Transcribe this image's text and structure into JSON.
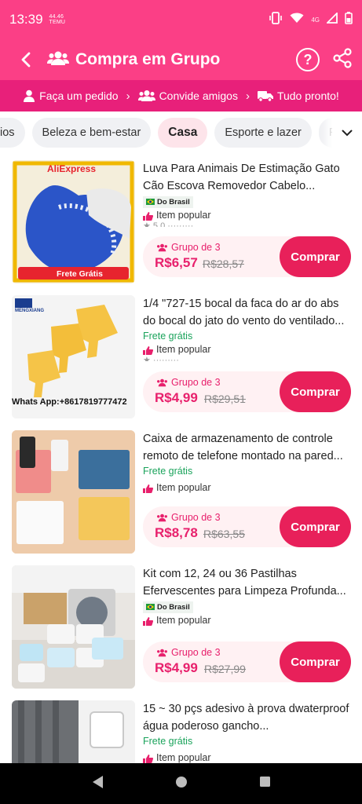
{
  "status": {
    "time": "13:39",
    "carrier": "44.46\nTEMU",
    "network": "4G"
  },
  "header": {
    "title": "Compra em Grupo"
  },
  "steps": [
    {
      "label": "Faça um pedido"
    },
    {
      "label": "Convide amigos"
    },
    {
      "label": "Tudo pronto!"
    }
  ],
  "categories": [
    {
      "label": "ios"
    },
    {
      "label": "Beleza e bem-estar"
    },
    {
      "label": "Casa"
    },
    {
      "label": "Esporte e lazer"
    },
    {
      "label": "F"
    }
  ],
  "products": [
    {
      "name": "Luva Para Animais De Estimação Gato Cão Escova Removedor Cabelo...",
      "origin": "Do Brasil",
      "shipping": "",
      "popular": "Item popular",
      "group": "Grupo de 3",
      "price": "R$6,57",
      "old_price": "R$28,57",
      "buy": "Comprar",
      "thumb_text_top": "AliExpress",
      "thumb_text_bottom": "Frete Grátis"
    },
    {
      "name": "1/4 \"727-15 bocal da faca do ar do abs do bocal do jato do vento do ventilado...",
      "origin": "",
      "shipping": "Frete grátis",
      "popular": "Item popular",
      "group": "Grupo de 3",
      "price": "R$4,99",
      "old_price": "R$29,51",
      "buy": "Comprar",
      "thumb_text_top": "MENGXIANG",
      "thumb_text_bottom": "Whats App:+8617819777472"
    },
    {
      "name": "Caixa de armazenamento de controle remoto de telefone montado na pared...",
      "origin": "",
      "shipping": "Frete grátis",
      "popular": "Item popular",
      "group": "Grupo de 3",
      "price": "R$8,78",
      "old_price": "R$63,55",
      "buy": "Comprar",
      "thumb_text_top": "",
      "thumb_text_bottom": ""
    },
    {
      "name": "Kit com 12, 24 ou 36 Pastilhas Efervescentes para Limpeza Profunda...",
      "origin": "Do Brasil",
      "shipping": "",
      "popular": "Item popular",
      "group": "Grupo de 3",
      "price": "R$4,99",
      "old_price": "R$27,99",
      "buy": "Comprar",
      "thumb_text_top": "",
      "thumb_text_bottom": ""
    },
    {
      "name": "15 ~ 30 pçs adesivo à prova dwaterproof água poderoso gancho...",
      "origin": "",
      "shipping": "Frete grátis",
      "popular": "Item popular",
      "group": "",
      "price": "",
      "old_price": "",
      "buy": "",
      "thumb_text_top": "",
      "thumb_text_bottom": ""
    }
  ],
  "colors": {
    "brand_pink": "#fb3f86",
    "steps_bar": "#e8207a",
    "price": "#e8206c",
    "buy_button": "#e8205a",
    "free_shipping": "#1aa35b"
  }
}
